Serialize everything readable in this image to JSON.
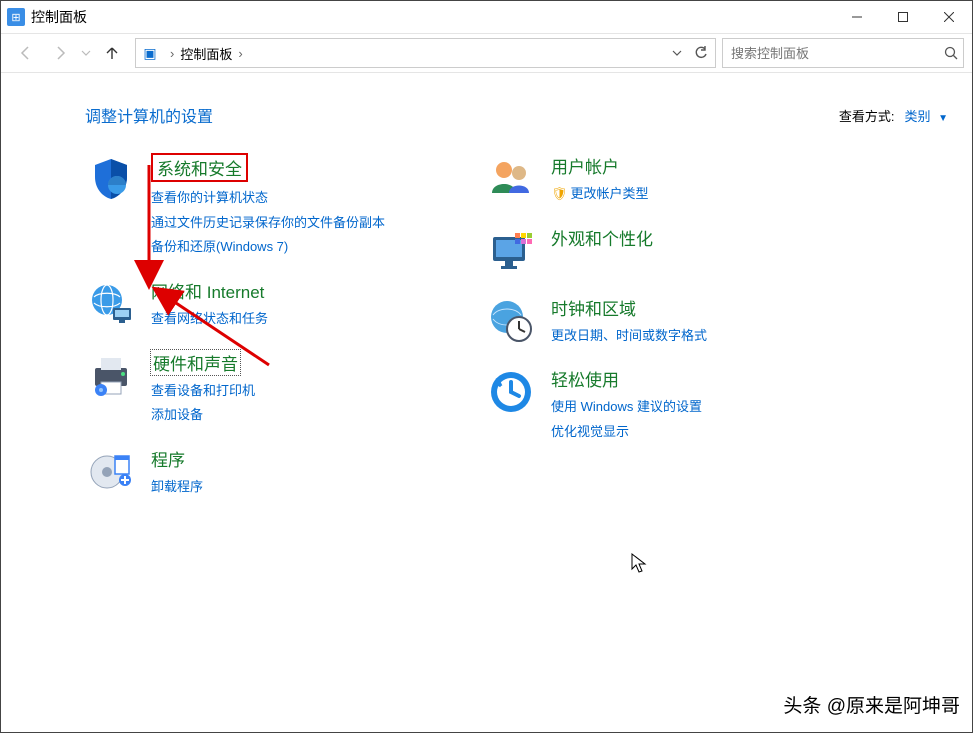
{
  "window": {
    "title": "控制面板"
  },
  "breadcrumb": {
    "root": "控制面板"
  },
  "search": {
    "placeholder": "搜索控制面板"
  },
  "header": {
    "title": "调整计算机的设置",
    "view_label": "查看方式:",
    "view_value": "类别"
  },
  "left_col": [
    {
      "title": "系统和安全",
      "subs": [
        "查看你的计算机状态",
        "通过文件历史记录保存你的文件备份副本",
        "备份和还原(Windows 7)"
      ],
      "style": "boxed"
    },
    {
      "title": "网络和 Internet",
      "subs": [
        "查看网络状态和任务"
      ]
    },
    {
      "title": "硬件和声音",
      "subs": [
        "查看设备和打印机",
        "添加设备"
      ],
      "style": "dotted"
    },
    {
      "title": "程序",
      "subs": [
        "卸载程序"
      ]
    }
  ],
  "right_col": [
    {
      "title": "用户帐户",
      "subs": [
        "更改帐户类型"
      ],
      "shield": [
        0
      ]
    },
    {
      "title": "外观和个性化",
      "subs": []
    },
    {
      "title": "时钟和区域",
      "subs": [
        "更改日期、时间或数字格式"
      ]
    },
    {
      "title": "轻松使用",
      "subs": [
        "使用 Windows 建议的设置",
        "优化视觉显示"
      ]
    }
  ],
  "watermark": "头条 @原来是阿坤哥"
}
